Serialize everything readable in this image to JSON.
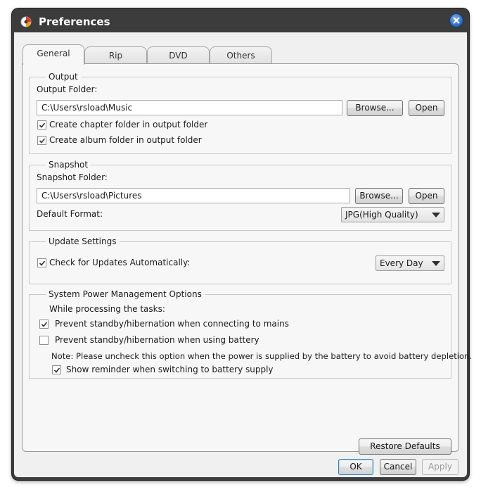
{
  "window": {
    "title": "Preferences"
  },
  "tabs": [
    {
      "label": "General",
      "active": true
    },
    {
      "label": "Rip",
      "active": false
    },
    {
      "label": "DVD",
      "active": false
    },
    {
      "label": "Others",
      "active": false
    }
  ],
  "output": {
    "legend": "Output",
    "folder_label": "Output Folder:",
    "folder_value": "C:\\Users\\rsload\\Music",
    "browse_label": "Browse...",
    "open_label": "Open",
    "chapter_folder_label": "Create chapter folder in output folder",
    "chapter_folder_checked": true,
    "album_folder_label": "Create album folder in output folder",
    "album_folder_checked": true
  },
  "snapshot": {
    "legend": "Snapshot",
    "folder_label": "Snapshot Folder:",
    "folder_value": "C:\\Users\\rsload\\Pictures",
    "browse_label": "Browse...",
    "open_label": "Open",
    "format_label": "Default Format:",
    "format_value": "JPG(High Quality)"
  },
  "update": {
    "legend": "Update Settings",
    "check_label": "Check for Updates Automatically:",
    "check_checked": true,
    "frequency_value": "Every Day"
  },
  "power": {
    "legend": "System Power Management Options",
    "while_label": "While processing the tasks:",
    "mains_label": "Prevent standby/hibernation when connecting to mains",
    "mains_checked": true,
    "battery_label": "Prevent standby/hibernation when using battery",
    "battery_checked": false,
    "note": "Note: Please uncheck this option when the power is supplied by the battery to avoid battery depletion.",
    "reminder_label": "Show reminder when switching to battery supply",
    "reminder_checked": true
  },
  "buttons": {
    "restore_defaults": "Restore Defaults",
    "ok": "OK",
    "cancel": "Cancel",
    "apply": "Apply"
  },
  "colors": {
    "titlebar": "#3c3c3c",
    "close_button": "#2a64b8"
  }
}
